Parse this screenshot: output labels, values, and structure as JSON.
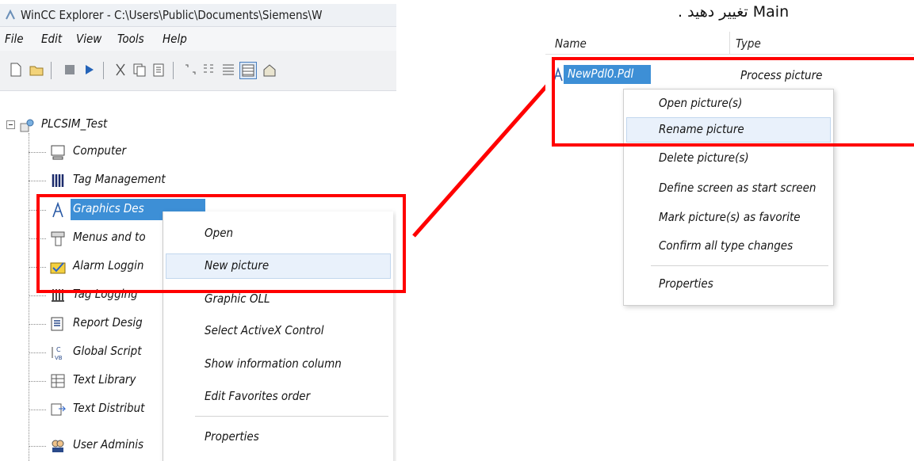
{
  "window": {
    "title": "WinCC Explorer - C:\\Users\\Public\\Documents\\Siemens\\W"
  },
  "menu": [
    "File",
    "Edit",
    "View",
    "Tools",
    "Help"
  ],
  "tree": {
    "root": "PLCSIM_Test",
    "items": [
      {
        "label": "Computer",
        "icon": "computer-icon"
      },
      {
        "label": "Tag Management",
        "icon": "tag-management-icon"
      },
      {
        "label": "Graphics Designer",
        "icon": "graphics-designer-icon",
        "visible_label": "Graphics Des"
      },
      {
        "label": "Menus and to",
        "icon": "menus-toolbars-icon"
      },
      {
        "label": "Alarm Loggin",
        "icon": "alarm-logging-icon"
      },
      {
        "label": "Tag Logging",
        "icon": "tag-logging-icon"
      },
      {
        "label": "Report Desig",
        "icon": "report-designer-icon"
      },
      {
        "label": "Global Script",
        "icon": "global-script-icon"
      },
      {
        "label": "Text Library",
        "icon": "text-library-icon"
      },
      {
        "label": "Text Distribut",
        "icon": "text-distributor-icon"
      },
      {
        "label": "User Adminis",
        "icon": "user-administrator-icon"
      }
    ]
  },
  "left_context_menu": [
    "Open",
    "New picture",
    "Graphic OLL",
    "Select ActiveX Control",
    "Show information column",
    "Edit Favorites order",
    "Properties"
  ],
  "right_panel": {
    "rtl_note": "Main تغییر دهید .",
    "columns": [
      "Name",
      "Type"
    ],
    "file": {
      "name": "NewPdl0.Pdl",
      "type": "Process picture"
    },
    "context_menu": [
      "Open picture(s)",
      "Rename picture",
      "Delete picture(s)",
      "Define screen as start screen",
      "Mark picture(s) as favorite",
      "Confirm all type changes",
      "Properties"
    ]
  },
  "colors": {
    "highlight_red": "#ff0000",
    "selection_blue": "#3d8fd6",
    "menu_hover": "#e9f1fb"
  }
}
